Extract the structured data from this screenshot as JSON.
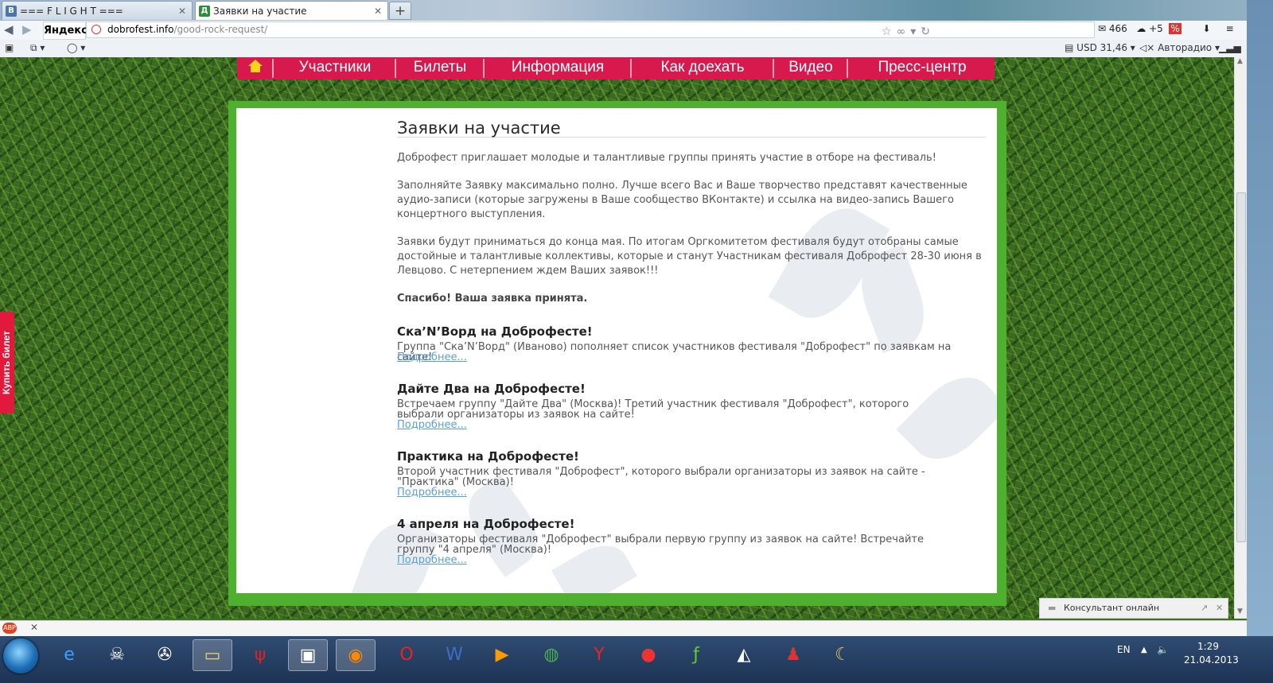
{
  "browser": {
    "tabs": [
      {
        "label": "=== F L I G H T ===",
        "favicon": "В"
      },
      {
        "label": "Заявки на участие",
        "favicon": "Д"
      }
    ],
    "new_tab": "+",
    "yandex_logo": "Яндекс",
    "url_domain": "dobrofest.info",
    "url_path": "/good-rock-request/",
    "mail_count": "466",
    "weather": "+5",
    "currency": "USD 31,46",
    "radio": "Авторадио"
  },
  "menu": {
    "items": [
      "Участники",
      "Билеты",
      "Информация",
      "Как доехать",
      "Видео",
      "Пресс-центр"
    ]
  },
  "article": {
    "title": "Заявки на участие",
    "p1": "Доброфест приглашает молодые и талантливые группы принять участие в отборе на фестиваль!",
    "p2": "Заполняйте Заявку максимально полно. Лучше всего Вас и Ваше творчество представят качественные аудио-записи (которые загружены в Ваше сообщество ВКонтакте) и ссылка на видео-запись Вашего концертного выступления.",
    "p3": "Заявки будут приниматься до конца мая. По итогам Оргкомитетом фестиваля будут отобраны самые достойные и талантливые коллективы, которые и станут Участникам фестиваля Доброфест 28-30 июня в Левцово. С нетерпением ждем Ваших заявок!!!",
    "thanks": "Спасибо! Ваша заявка принята."
  },
  "news": [
    {
      "title": "Ска’N’Ворд на Доброфесте!",
      "text": "Группа \"Ска’N’Ворд\" (Иваново) пополняет список участников фестиваля \"Доброфест\" по заявкам на сайте!",
      "more": "Подробнее..."
    },
    {
      "title": "Дайте Два на Доброфесте!",
      "text": "Встречаем группу \"Дайте Два\" (Москва)! Третий участник фестиваля \"Доброфест\", которого выбрали организаторы из заявок на сайте!",
      "more": "Подробнее..."
    },
    {
      "title": "Практика на Доброфесте!",
      "text": "Второй участник фестиваля \"Доброфест\", которого выбрали организаторы из заявок на сайте - \"Практика\" (Москва)!",
      "more": "Подробнее..."
    },
    {
      "title": "4 апреля на Доброфесте!",
      "text": "Организаторы фестиваля \"Доброфест\" выбрали первую группу из заявок на сайте! Встречайте группу \"4 апреля\" (Москва)!",
      "more": "Подробнее..."
    }
  ],
  "buy_ticket": "Купить билет",
  "consultant": "Консультант онлайн",
  "taskbar": {
    "lang": "EN",
    "time": "1:29",
    "date": "21.04.2013",
    "icons": [
      "ie-icon",
      "alien-icon",
      "film-reel-icon",
      "folder-icon",
      "quake-icon",
      "terminal-icon",
      "firefox-icon",
      "opera-icon",
      "word-icon",
      "media-player-icon",
      "chrome-icon",
      "yandex-browser-icon",
      "record-icon",
      "flash-icon",
      "steam-icon",
      "joystick-icon",
      "moon-icon"
    ]
  },
  "colors": {
    "menu": "#d8194e",
    "frame_green": "#4fb02f",
    "link": "#5aa0d8"
  }
}
